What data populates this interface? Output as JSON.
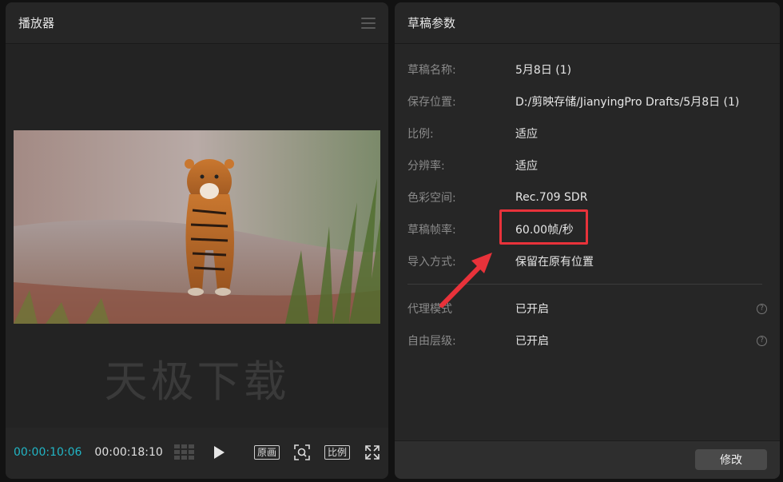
{
  "player": {
    "title": "播放器",
    "watermark": "天极下载",
    "current_time": "00:00:10:06",
    "total_time": "00:00:18:10",
    "original_label": "原画",
    "ratio_label": "比例"
  },
  "draft": {
    "title": "草稿参数",
    "rows": [
      {
        "label": "草稿名称:",
        "value": "5月8日 (1)"
      },
      {
        "label": "保存位置:",
        "value": "D:/剪映存储/JianyingPro Drafts/5月8日 (1)"
      },
      {
        "label": "比例:",
        "value": "适应"
      },
      {
        "label": "分辨率:",
        "value": "适应"
      },
      {
        "label": "色彩空间:",
        "value": "Rec.709 SDR"
      },
      {
        "label": "草稿帧率:",
        "value": "60.00帧/秒"
      },
      {
        "label": "导入方式:",
        "value": "保留在原有位置"
      }
    ],
    "extra_rows": [
      {
        "label": "代理模式",
        "value": "已开启",
        "help": "?"
      },
      {
        "label": "自由层级:",
        "value": "已开启",
        "help": "?"
      }
    ],
    "modify_label": "修改"
  },
  "colors": {
    "accent_timecode": "#21b5c5",
    "annotation_red": "#e8323a",
    "panel_bg": "#262626"
  }
}
